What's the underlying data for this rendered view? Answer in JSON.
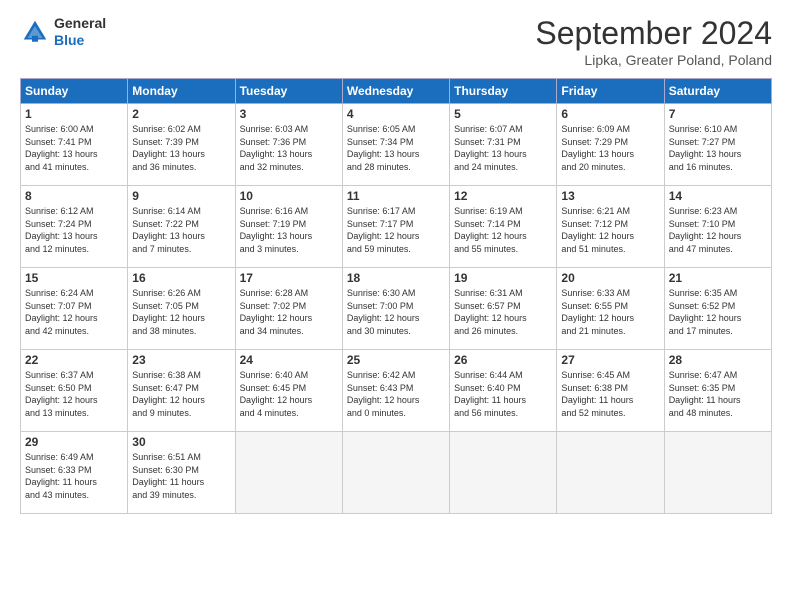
{
  "header": {
    "logo_general": "General",
    "logo_blue": "Blue",
    "month_title": "September 2024",
    "subtitle": "Lipka, Greater Poland, Poland"
  },
  "weekdays": [
    "Sunday",
    "Monday",
    "Tuesday",
    "Wednesday",
    "Thursday",
    "Friday",
    "Saturday"
  ],
  "weeks": [
    [
      {
        "day": "1",
        "info": "Sunrise: 6:00 AM\nSunset: 7:41 PM\nDaylight: 13 hours\nand 41 minutes."
      },
      {
        "day": "2",
        "info": "Sunrise: 6:02 AM\nSunset: 7:39 PM\nDaylight: 13 hours\nand 36 minutes."
      },
      {
        "day": "3",
        "info": "Sunrise: 6:03 AM\nSunset: 7:36 PM\nDaylight: 13 hours\nand 32 minutes."
      },
      {
        "day": "4",
        "info": "Sunrise: 6:05 AM\nSunset: 7:34 PM\nDaylight: 13 hours\nand 28 minutes."
      },
      {
        "day": "5",
        "info": "Sunrise: 6:07 AM\nSunset: 7:31 PM\nDaylight: 13 hours\nand 24 minutes."
      },
      {
        "day": "6",
        "info": "Sunrise: 6:09 AM\nSunset: 7:29 PM\nDaylight: 13 hours\nand 20 minutes."
      },
      {
        "day": "7",
        "info": "Sunrise: 6:10 AM\nSunset: 7:27 PM\nDaylight: 13 hours\nand 16 minutes."
      }
    ],
    [
      {
        "day": "8",
        "info": "Sunrise: 6:12 AM\nSunset: 7:24 PM\nDaylight: 13 hours\nand 12 minutes."
      },
      {
        "day": "9",
        "info": "Sunrise: 6:14 AM\nSunset: 7:22 PM\nDaylight: 13 hours\nand 7 minutes."
      },
      {
        "day": "10",
        "info": "Sunrise: 6:16 AM\nSunset: 7:19 PM\nDaylight: 13 hours\nand 3 minutes."
      },
      {
        "day": "11",
        "info": "Sunrise: 6:17 AM\nSunset: 7:17 PM\nDaylight: 12 hours\nand 59 minutes."
      },
      {
        "day": "12",
        "info": "Sunrise: 6:19 AM\nSunset: 7:14 PM\nDaylight: 12 hours\nand 55 minutes."
      },
      {
        "day": "13",
        "info": "Sunrise: 6:21 AM\nSunset: 7:12 PM\nDaylight: 12 hours\nand 51 minutes."
      },
      {
        "day": "14",
        "info": "Sunrise: 6:23 AM\nSunset: 7:10 PM\nDaylight: 12 hours\nand 47 minutes."
      }
    ],
    [
      {
        "day": "15",
        "info": "Sunrise: 6:24 AM\nSunset: 7:07 PM\nDaylight: 12 hours\nand 42 minutes."
      },
      {
        "day": "16",
        "info": "Sunrise: 6:26 AM\nSunset: 7:05 PM\nDaylight: 12 hours\nand 38 minutes."
      },
      {
        "day": "17",
        "info": "Sunrise: 6:28 AM\nSunset: 7:02 PM\nDaylight: 12 hours\nand 34 minutes."
      },
      {
        "day": "18",
        "info": "Sunrise: 6:30 AM\nSunset: 7:00 PM\nDaylight: 12 hours\nand 30 minutes."
      },
      {
        "day": "19",
        "info": "Sunrise: 6:31 AM\nSunset: 6:57 PM\nDaylight: 12 hours\nand 26 minutes."
      },
      {
        "day": "20",
        "info": "Sunrise: 6:33 AM\nSunset: 6:55 PM\nDaylight: 12 hours\nand 21 minutes."
      },
      {
        "day": "21",
        "info": "Sunrise: 6:35 AM\nSunset: 6:52 PM\nDaylight: 12 hours\nand 17 minutes."
      }
    ],
    [
      {
        "day": "22",
        "info": "Sunrise: 6:37 AM\nSunset: 6:50 PM\nDaylight: 12 hours\nand 13 minutes."
      },
      {
        "day": "23",
        "info": "Sunrise: 6:38 AM\nSunset: 6:47 PM\nDaylight: 12 hours\nand 9 minutes."
      },
      {
        "day": "24",
        "info": "Sunrise: 6:40 AM\nSunset: 6:45 PM\nDaylight: 12 hours\nand 4 minutes."
      },
      {
        "day": "25",
        "info": "Sunrise: 6:42 AM\nSunset: 6:43 PM\nDaylight: 12 hours\nand 0 minutes."
      },
      {
        "day": "26",
        "info": "Sunrise: 6:44 AM\nSunset: 6:40 PM\nDaylight: 11 hours\nand 56 minutes."
      },
      {
        "day": "27",
        "info": "Sunrise: 6:45 AM\nSunset: 6:38 PM\nDaylight: 11 hours\nand 52 minutes."
      },
      {
        "day": "28",
        "info": "Sunrise: 6:47 AM\nSunset: 6:35 PM\nDaylight: 11 hours\nand 48 minutes."
      }
    ],
    [
      {
        "day": "29",
        "info": "Sunrise: 6:49 AM\nSunset: 6:33 PM\nDaylight: 11 hours\nand 43 minutes."
      },
      {
        "day": "30",
        "info": "Sunrise: 6:51 AM\nSunset: 6:30 PM\nDaylight: 11 hours\nand 39 minutes."
      },
      null,
      null,
      null,
      null,
      null
    ]
  ]
}
